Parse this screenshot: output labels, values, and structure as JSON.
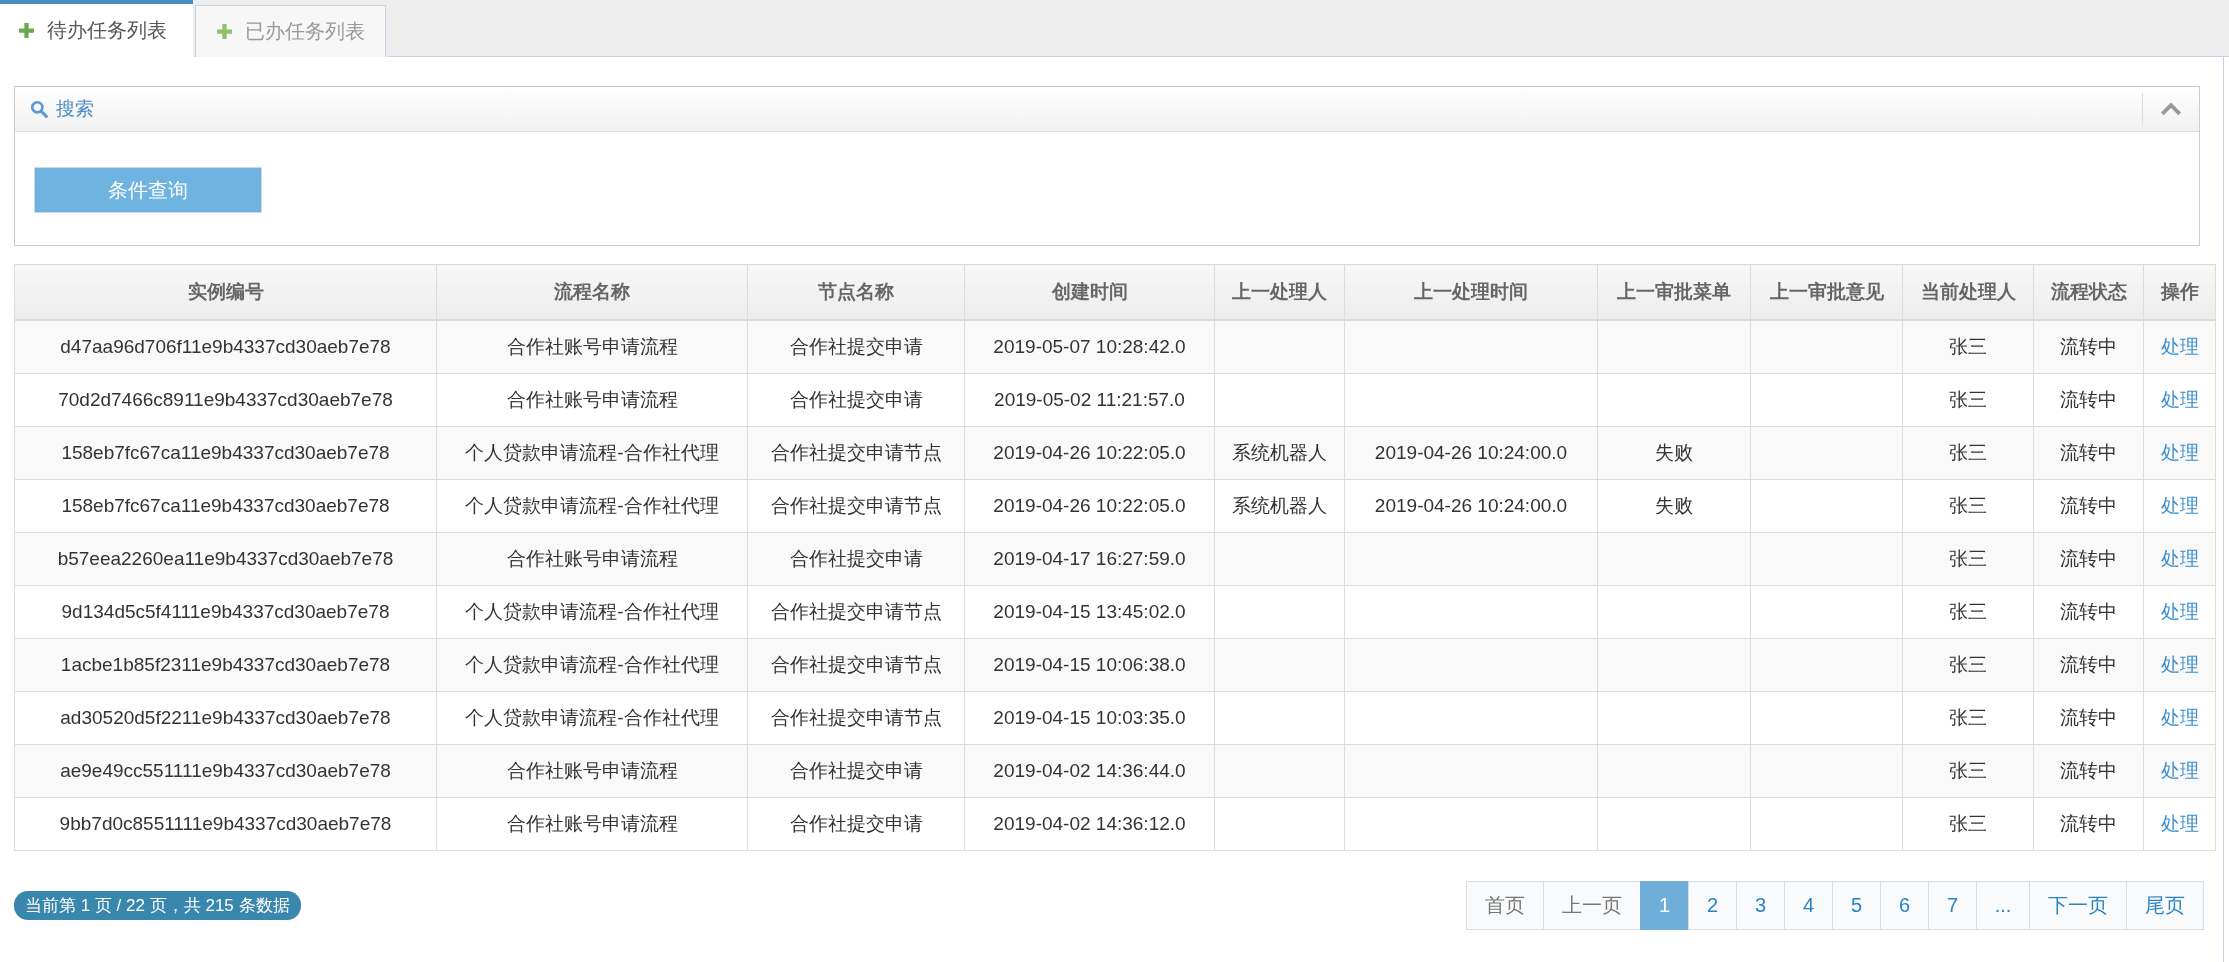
{
  "tabs": [
    {
      "label": "待办任务列表",
      "selected": true
    },
    {
      "label": "已办任务列表",
      "selected": false
    }
  ],
  "search_panel": {
    "title": "搜索",
    "expanded": true,
    "button": "条件查询"
  },
  "table": {
    "columns": [
      "实例编号",
      "流程名称",
      "节点名称",
      "创建时间",
      "上一处理人",
      "上一处理时间",
      "上一审批菜单",
      "上一审批意见",
      "当前处理人",
      "流程状态",
      "操作"
    ],
    "rows": [
      [
        "d47aa96d706f11e9b4337cd30aeb7e78",
        "合作社账号申请流程",
        "合作社提交申请",
        "2019-05-07 10:28:42.0",
        "",
        "",
        "",
        "",
        "张三",
        "流转中",
        "处理"
      ],
      [
        "70d2d7466c8911e9b4337cd30aeb7e78",
        "合作社账号申请流程",
        "合作社提交申请",
        "2019-05-02 11:21:57.0",
        "",
        "",
        "",
        "",
        "张三",
        "流转中",
        "处理"
      ],
      [
        "158eb7fc67ca11e9b4337cd30aeb7e78",
        "个人贷款申请流程-合作社代理",
        "合作社提交申请节点",
        "2019-04-26 10:22:05.0",
        "系统机器人",
        "2019-04-26 10:24:00.0",
        "失败",
        "",
        "张三",
        "流转中",
        "处理"
      ],
      [
        "158eb7fc67ca11e9b4337cd30aeb7e78",
        "个人贷款申请流程-合作社代理",
        "合作社提交申请节点",
        "2019-04-26 10:22:05.0",
        "系统机器人",
        "2019-04-26 10:24:00.0",
        "失败",
        "",
        "张三",
        "流转中",
        "处理"
      ],
      [
        "b57eea2260ea11e9b4337cd30aeb7e78",
        "合作社账号申请流程",
        "合作社提交申请",
        "2019-04-17 16:27:59.0",
        "",
        "",
        "",
        "",
        "张三",
        "流转中",
        "处理"
      ],
      [
        "9d134d5c5f4111e9b4337cd30aeb7e78",
        "个人贷款申请流程-合作社代理",
        "合作社提交申请节点",
        "2019-04-15 13:45:02.0",
        "",
        "",
        "",
        "",
        "张三",
        "流转中",
        "处理"
      ],
      [
        "1acbe1b85f2311e9b4337cd30aeb7e78",
        "个人贷款申请流程-合作社代理",
        "合作社提交申请节点",
        "2019-04-15 10:06:38.0",
        "",
        "",
        "",
        "",
        "张三",
        "流转中",
        "处理"
      ],
      [
        "ad30520d5f2211e9b4337cd30aeb7e78",
        "个人贷款申请流程-合作社代理",
        "合作社提交申请节点",
        "2019-04-15 10:03:35.0",
        "",
        "",
        "",
        "",
        "张三",
        "流转中",
        "处理"
      ],
      [
        "ae9e49cc551111e9b4337cd30aeb7e78",
        "合作社账号申请流程",
        "合作社提交申请",
        "2019-04-02 14:36:44.0",
        "",
        "",
        "",
        "",
        "张三",
        "流转中",
        "处理"
      ],
      [
        "9bb7d0c8551111e9b4337cd30aeb7e78",
        "合作社账号申请流程",
        "合作社提交申请",
        "2019-04-02 14:36:12.0",
        "",
        "",
        "",
        "",
        "张三",
        "流转中",
        "处理"
      ]
    ]
  },
  "page_info": "当前第 1 页 / 22 页，共 215 条数据",
  "pagination": [
    {
      "label": "首页",
      "kind": "nav",
      "disabled": true,
      "selected": false
    },
    {
      "label": "上一页",
      "kind": "nav",
      "disabled": true,
      "selected": false
    },
    {
      "label": "1",
      "kind": "page",
      "disabled": false,
      "selected": true
    },
    {
      "label": "2",
      "kind": "page",
      "disabled": false,
      "selected": false
    },
    {
      "label": "3",
      "kind": "page",
      "disabled": false,
      "selected": false
    },
    {
      "label": "4",
      "kind": "page",
      "disabled": false,
      "selected": false
    },
    {
      "label": "5",
      "kind": "page",
      "disabled": false,
      "selected": false
    },
    {
      "label": "6",
      "kind": "page",
      "disabled": false,
      "selected": false
    },
    {
      "label": "7",
      "kind": "page",
      "disabled": false,
      "selected": false
    },
    {
      "label": "...",
      "kind": "ellipsis",
      "disabled": false,
      "selected": false
    },
    {
      "label": "下一页",
      "kind": "nav",
      "disabled": false,
      "selected": false
    },
    {
      "label": "尾页",
      "kind": "nav",
      "disabled": false,
      "selected": false
    }
  ]
}
